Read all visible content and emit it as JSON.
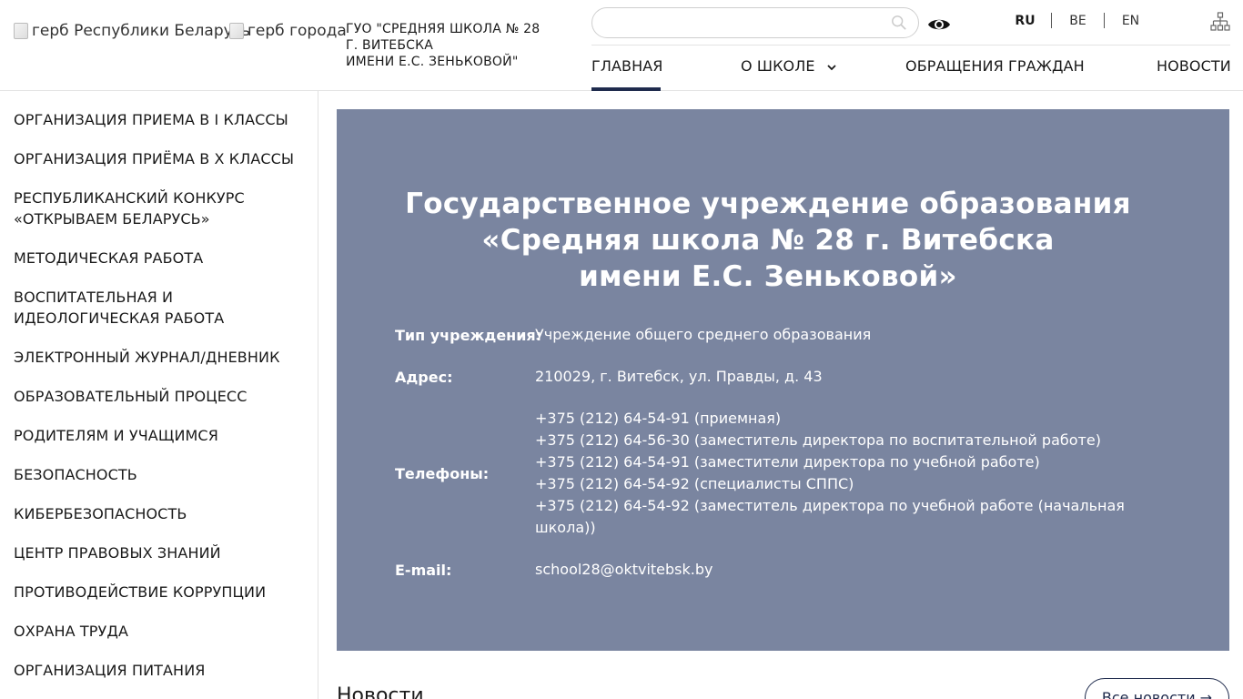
{
  "header": {
    "logo_republic_alt": "герб Республики Беларусь",
    "logo_city_alt": "герб города",
    "school_name_lines": [
      "ГУО \"СРЕДНЯЯ ШКОЛА № 28",
      "Г. ВИТЕБСКА",
      "ИМЕНИ Е.С. ЗЕНЬКОВОЙ\""
    ],
    "search_placeholder": "",
    "languages": [
      {
        "code": "RU",
        "active": true
      },
      {
        "code": "BE",
        "active": false
      },
      {
        "code": "EN",
        "active": false
      }
    ],
    "icons": {
      "search": "search-icon",
      "visually_impaired": "eye-icon",
      "sitemap": "sitemap-icon",
      "dropdown": "chevron-down-icon"
    }
  },
  "nav": {
    "items": [
      {
        "label": "ГЛАВНАЯ",
        "active": true
      },
      {
        "label": "О ШКОЛЕ",
        "has_dropdown": true
      },
      {
        "label": "ОБРАЩЕНИЯ ГРАЖДАН"
      },
      {
        "label": "НОВОСТИ"
      }
    ],
    "accent_color": "#1f2b4d"
  },
  "sidebar": {
    "items": [
      {
        "label": "ОРГАНИЗАЦИЯ ПРИЕМА В I КЛАССЫ"
      },
      {
        "label": "ОРГАНИЗАЦИЯ ПРИЁМА В Х КЛАССЫ"
      },
      {
        "label": "РЕСПУБЛИКАНСКИЙ КОНКУРС «ОТКРЫВАЕМ БЕЛАРУСЬ»"
      },
      {
        "label": "МЕТОДИЧЕСКАЯ РАБОТА"
      },
      {
        "label": "ВОСПИТАТЕЛЬНАЯ И ИДЕОЛОГИЧЕСКАЯ РАБОТА"
      },
      {
        "label": "ЭЛЕКТРОННЫЙ ЖУРНАЛ/ДНЕВНИК"
      },
      {
        "label": "ОБРАЗОВАТЕЛЬНЫЙ ПРОЦЕСС"
      },
      {
        "label": "РОДИТЕЛЯМ И УЧАЩИМСЯ"
      },
      {
        "label": "БЕЗОПАСНОСТЬ"
      },
      {
        "label": "КИБЕРБЕЗОПАСНОСТЬ"
      },
      {
        "label": "ЦЕНТР ПРАВОВЫХ ЗНАНИЙ"
      },
      {
        "label": "ПРОТИВОДЕЙСТВИЕ КОРРУПЦИИ"
      },
      {
        "label": "ОХРАНА ТРУДА"
      },
      {
        "label": "ОРГАНИЗАЦИЯ ПИТАНИЯ"
      }
    ]
  },
  "hero": {
    "background_color": "#7a85a0",
    "title_lines": [
      "Государственное учреждение образования",
      "«Средняя школа № 28 г. Витебска",
      "имени Е.С. Зеньковой»"
    ],
    "type_label": "Тип учреждения:",
    "type_value": "Учреждение общего среднего образования",
    "address_label": "Адрес:",
    "address_value": "210029, г. Витебск, ул. Правды, д. 43",
    "phones_label": "Телефоны:",
    "phones": [
      "+375 (212) 64-54-91 (приемная)",
      "+375 (212) 64-56-30 (заместитель директора по воспитательной работе)",
      "+375 (212) 64-54-91 (заместители директора по учебной работе)",
      "+375 (212) 64-54-92  (специалисты СППС)",
      "+375 (212) 64-54-92 (заместитель директора по учебной работе (начальная",
      "школа))"
    ],
    "email_label": "E-mail:",
    "email_value": "school28@oktvitebsk.by"
  },
  "news": {
    "title": "Новости",
    "all_news_label": "Все новости →"
  }
}
